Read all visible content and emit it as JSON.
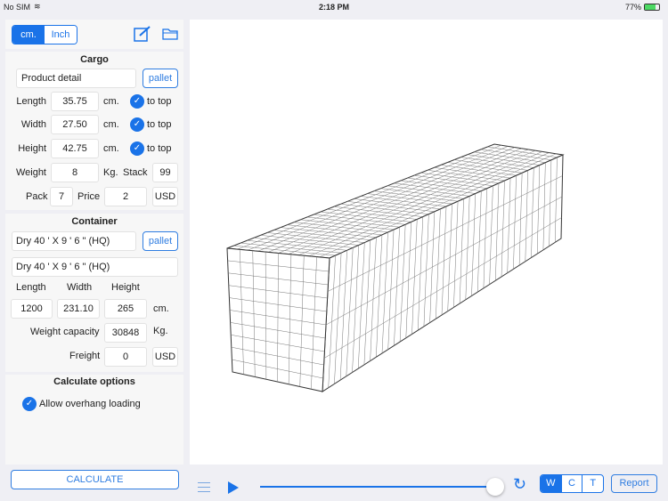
{
  "status": {
    "carrier": "No SIM",
    "time": "2:18 PM",
    "battery": "77%"
  },
  "units": {
    "cm": "cm.",
    "inch": "Inch",
    "selected": "cm"
  },
  "cargo": {
    "title": "Cargo",
    "product": "Product detail",
    "pallet": "pallet",
    "length": {
      "label": "Length",
      "value": "35.75",
      "unit": "cm.",
      "to_top": "to top"
    },
    "width": {
      "label": "Width",
      "value": "27.50",
      "unit": "cm.",
      "to_top": "to top"
    },
    "height": {
      "label": "Height",
      "value": "42.75",
      "unit": "cm.",
      "to_top": "to top"
    },
    "weight": {
      "label": "Weight",
      "value": "8",
      "unit": "Kg."
    },
    "stack": {
      "label": "Stack",
      "value": "99"
    },
    "pack": {
      "label": "Pack",
      "value": "7"
    },
    "price": {
      "label": "Price",
      "value": "2",
      "currency": "USD"
    }
  },
  "container": {
    "title": "Container",
    "type": "Dry 40 ' X 9 ' 6 \"  (HQ)",
    "pallet": "pallet",
    "name": "Dry 40 ' X 9 ' 6 \"  (HQ)",
    "length_label": "Length",
    "width_label": "Width",
    "height_label": "Height",
    "length": "1200",
    "width": "231.10",
    "height": "265",
    "unit": "cm.",
    "capacity_label": "Weight capacity",
    "capacity": "30848",
    "capacity_unit": "Kg.",
    "freight_label": "Freight",
    "freight": "0",
    "currency": "USD"
  },
  "options": {
    "title": "Calculate options",
    "overhang": "Allow overhang loading"
  },
  "calculate": "CALCULATE",
  "toolbar": {
    "progress": 1.0,
    "views": [
      "W",
      "C",
      "T"
    ],
    "selected_view": "W",
    "report": "Report"
  },
  "colors": {
    "accent": "#1a73e8"
  }
}
